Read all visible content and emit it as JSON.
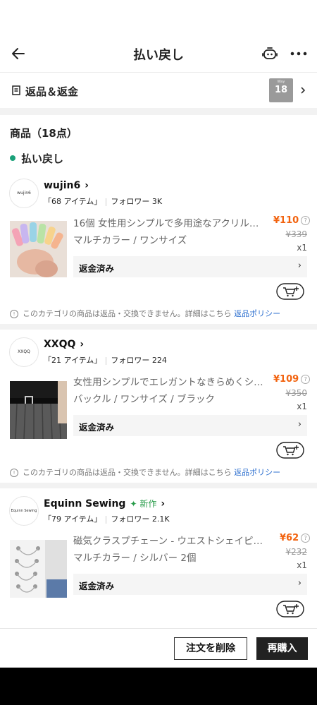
{
  "header": {
    "title": "払い戻し"
  },
  "returns": {
    "label": "返品＆返金",
    "thumb_count": "18",
    "thumb_caption": "Way"
  },
  "products": {
    "title": "商品（18点）"
  },
  "status": {
    "label": "払い戻し",
    "color": "#1aa179"
  },
  "stores": [
    {
      "name": "wujin6",
      "logo_text": "wujin6",
      "is_new": false,
      "items_count": "「68 アイテム」",
      "followers": "フォロワー 3K",
      "product": {
        "title": "16個 女性用シンプルで多用途なアクリルヘ…",
        "variant": "マルチカラー / ワンサイズ",
        "price": "¥110",
        "original_price": "¥339",
        "quantity": "x1",
        "refund_status": "返金済み"
      }
    },
    {
      "name": "XXQQ",
      "logo_text": "XXQQ",
      "is_new": false,
      "items_count": "「21 アイテム」",
      "followers": "フォロワー 224",
      "product": {
        "title": "女性用シンプルでエレガントなきらめくシ…",
        "variant": "バックル / ワンサイズ / ブラック",
        "price": "¥109",
        "original_price": "¥350",
        "quantity": "x1",
        "refund_status": "返金済み"
      }
    },
    {
      "name": "Equinn Sewing",
      "logo_text": "Equinn Sewing",
      "is_new": true,
      "new_label": "新作",
      "items_count": "「79 アイテム」",
      "followers": "フォロワー 2.1K",
      "product": {
        "title": "磁気クラスプチェーン - ウエストシェイピン…",
        "variant": "マルチカラー / シルバー 2個",
        "price": "¥62",
        "original_price": "¥232",
        "quantity": "x1",
        "refund_status": "返金済み"
      }
    }
  ],
  "policy": {
    "text": "このカテゴリの商品は返品・交換できません。詳細はこちら",
    "link": "返品ポリシー"
  },
  "actions": {
    "delete_order": "注文を削除",
    "repurchase": "再購入"
  },
  "colors": {
    "price": "#f2630f",
    "link": "#2d6fcf",
    "new_tag": "#2a9d4b"
  }
}
